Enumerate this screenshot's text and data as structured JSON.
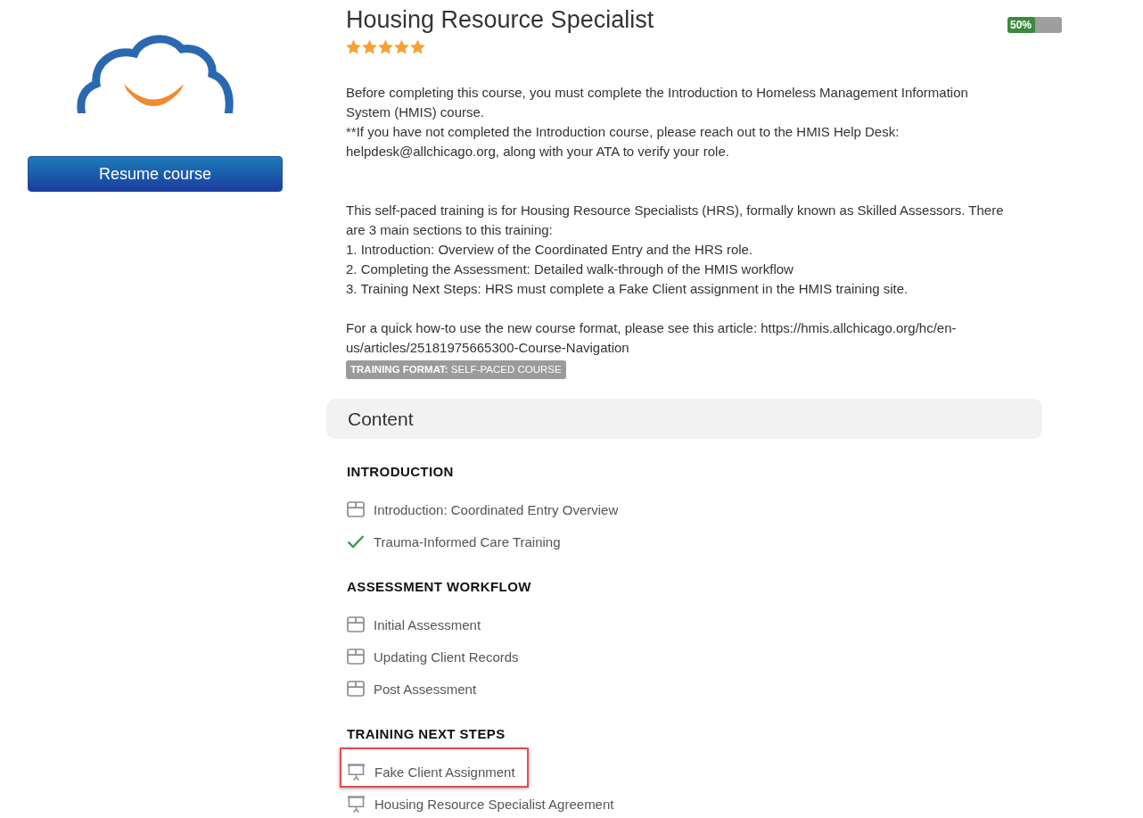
{
  "sidebar": {
    "resume_button": "Resume course"
  },
  "course": {
    "title": "Housing Resource Specialist",
    "rating": {
      "stars": 5
    },
    "progress": {
      "label": "50%",
      "level": 0.5
    }
  },
  "description": {
    "prerequisite": [
      "Before completing this course, you must complete the Introduction to Homeless Management Information System (HMIS) course.",
      "**If you have not completed the Introduction course, please reach out to the HMIS Help Desk: helpdesk@allchicago.org, along with your ATA to verify your role."
    ],
    "overview": [
      "This self-paced training is for Housing Resource Specialists (HRS), formally known as Skilled Assessors. There are 3 main sections to this training:",
      "1. Introduction: Overview of the Coordinated Entry and the HRS role.",
      "2. Completing the Assessment: Detailed walk-through of the HMIS workflow",
      "3. Training Next Steps: HRS must complete a Fake Client assignment in the HMIS training site."
    ],
    "article_note": "For a quick how-to use the new course format, please see this article: https://hmis.allchicago.org/hc/en-us/articles/25181975665300-Course-Navigation",
    "format_badge": "**TRAINING FORMAT:** SELF-PACED COURSE"
  },
  "content": {
    "heading": "Content",
    "sections": [
      {
        "title": "INTRODUCTION",
        "items": [
          {
            "title": "Introduction: Coordinated Entry Overview",
            "kind": "lesson",
            "highlighted": false
          },
          {
            "title": "Trauma-Informed Care Training",
            "kind": "completed",
            "highlighted": false
          }
        ]
      },
      {
        "title": "ASSESSMENT WORKFLOW",
        "items": [
          {
            "title": "Initial Assessment",
            "kind": "lesson",
            "highlighted": false
          },
          {
            "title": "Updating Client Records",
            "kind": "lesson",
            "highlighted": false
          },
          {
            "title": "Post Assessment",
            "kind": "lesson",
            "highlighted": false
          }
        ]
      },
      {
        "title": "TRAINING NEXT STEPS",
        "items": [
          {
            "title": "Fake Client Assignment",
            "kind": "presentation",
            "highlighted": true
          },
          {
            "title": "Housing Resource Specialist Agreement",
            "kind": "presentation",
            "highlighted": false
          }
        ]
      }
    ]
  }
}
